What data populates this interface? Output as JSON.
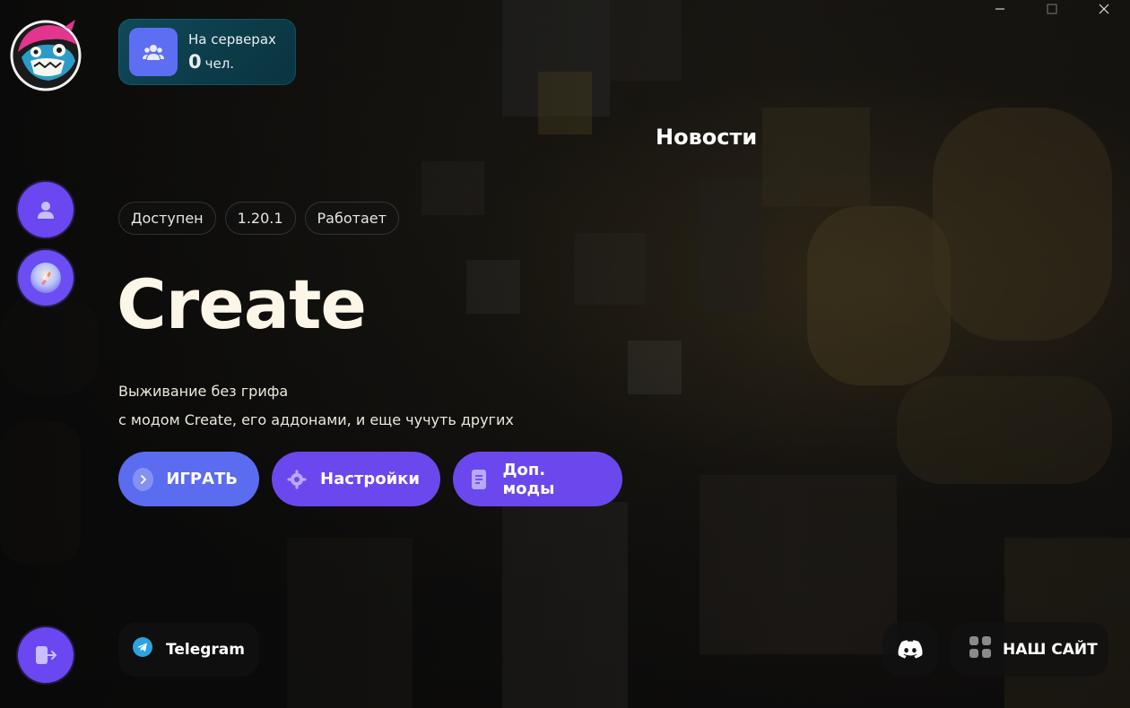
{
  "window": {
    "controls": [
      "minimize-icon",
      "maximize-icon",
      "close-icon"
    ]
  },
  "sidebar": {
    "items": [
      {
        "name": "profile",
        "icon": "user-icon"
      },
      {
        "name": "server-avatar",
        "icon": "server-avatar-icon"
      },
      {
        "name": "logout",
        "icon": "logout-icon"
      }
    ]
  },
  "online": {
    "label": "На серверах",
    "count": "0",
    "unit": "чел.",
    "icon": "users-icon"
  },
  "news": {
    "title": "Новости"
  },
  "server": {
    "chips": [
      "Доступен",
      "1.20.1",
      "Работает"
    ],
    "title": "Create",
    "description": [
      "Выживание без грифа",
      "с модом Create, его аддонами, и еще чучуть других"
    ]
  },
  "actions": {
    "play_label": "ИГРАТЬ",
    "settings_label": "Настройки",
    "mods_label": "Доп. моды"
  },
  "links": {
    "telegram_label": "Telegram",
    "site_label": "НАШ САЙТ",
    "discord_icon": "discord-icon"
  },
  "colors": {
    "accent": "#6b48ee",
    "play": "#5b6cf0",
    "online_card": "#0c3b48",
    "online_icon_bg": "#5d6ef2"
  }
}
